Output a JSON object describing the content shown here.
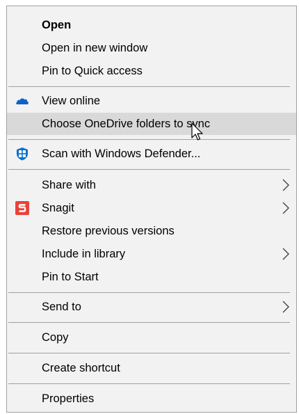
{
  "menu": {
    "items": [
      {
        "label": "Open",
        "bold": true
      },
      {
        "label": "Open in new window"
      },
      {
        "label": "Pin to Quick access"
      },
      {
        "label": "View online",
        "icon": "onedrive-cloud-icon"
      },
      {
        "label": "Choose OneDrive folders to sync",
        "highlighted": true
      },
      {
        "label": "Scan with Windows Defender...",
        "icon": "windows-defender-icon"
      },
      {
        "label": "Share with",
        "submenu": true
      },
      {
        "label": "Snagit",
        "icon": "snagit-icon",
        "submenu": true
      },
      {
        "label": "Restore previous versions"
      },
      {
        "label": "Include in library",
        "submenu": true
      },
      {
        "label": "Pin to Start"
      },
      {
        "label": "Send to",
        "submenu": true
      },
      {
        "label": "Copy"
      },
      {
        "label": "Create shortcut"
      },
      {
        "label": "Properties"
      }
    ]
  },
  "colors": {
    "menu_background": "#f2f2f2",
    "hover_background": "#d9d9d9",
    "separator": "#a0a0a0",
    "onedrive_blue": "#0b62c9",
    "defender_blue": "#0a70c9",
    "snagit_red": "#e8423a"
  }
}
